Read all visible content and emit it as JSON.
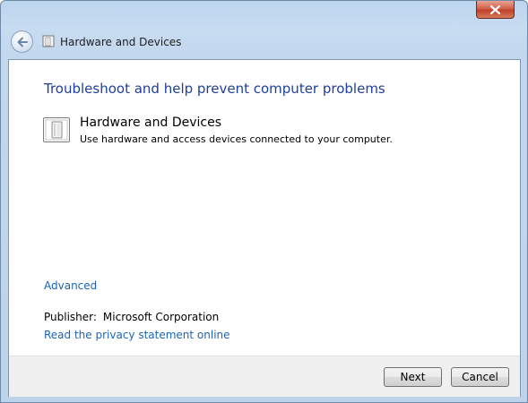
{
  "window": {
    "title": "Hardware and Devices",
    "close_icon": "close-x-icon",
    "back_icon": "back-arrow-icon"
  },
  "main": {
    "heading": "Troubleshoot and help prevent computer problems",
    "item": {
      "title": "Hardware and Devices",
      "description": "Use hardware and access devices connected to your computer.",
      "icon": "hardware-device-icon"
    },
    "advanced_link": "Advanced",
    "publisher_label": "Publisher:",
    "publisher_value": "Microsoft Corporation",
    "privacy_link": "Read the privacy statement online"
  },
  "footer": {
    "next_label": "Next",
    "cancel_label": "Cancel"
  },
  "colors": {
    "heading": "#1e3f9b",
    "link": "#1c64b4",
    "close_button": "#c2412a"
  }
}
